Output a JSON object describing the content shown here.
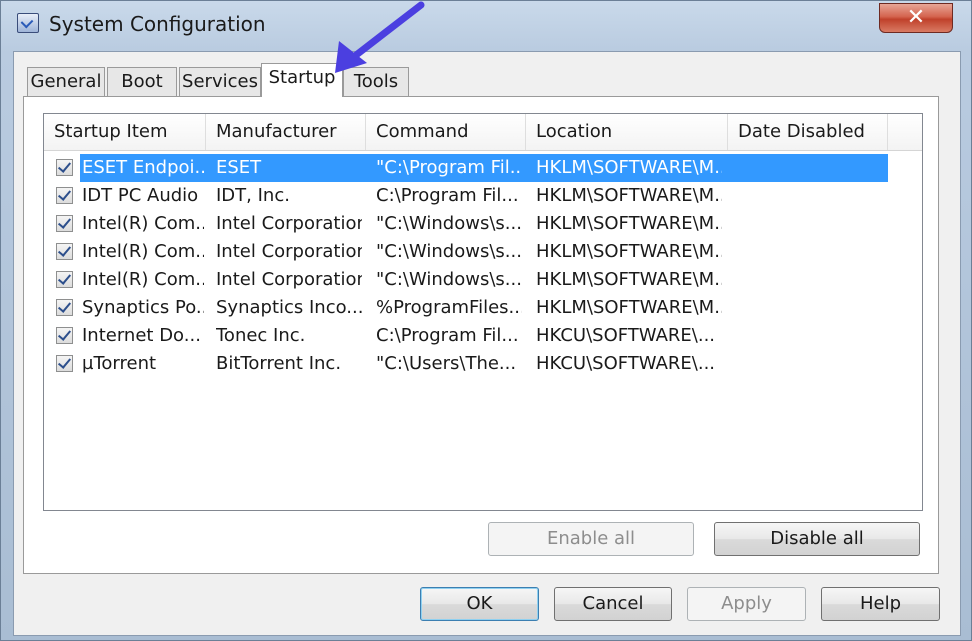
{
  "window": {
    "title": "System Configuration",
    "close_glyph": "✕"
  },
  "tabs": [
    {
      "label": "General",
      "active": false
    },
    {
      "label": "Boot",
      "active": false
    },
    {
      "label": "Services",
      "active": false
    },
    {
      "label": "Startup",
      "active": true
    },
    {
      "label": "Tools",
      "active": false
    }
  ],
  "startup_list": {
    "columns": [
      "Startup Item",
      "Manufacturer",
      "Command",
      "Location",
      "Date Disabled"
    ],
    "rows": [
      {
        "checked": true,
        "selected": true,
        "item": "ESET Endpoi...",
        "manufacturer": "ESET",
        "command": "\"C:\\Program Fil...",
        "location": "HKLM\\SOFTWARE\\M...",
        "date_disabled": ""
      },
      {
        "checked": true,
        "selected": false,
        "item": "IDT PC Audio",
        "manufacturer": "IDT, Inc.",
        "command": "C:\\Program Fil...",
        "location": "HKLM\\SOFTWARE\\M...",
        "date_disabled": ""
      },
      {
        "checked": true,
        "selected": false,
        "item": "Intel(R) Com...",
        "manufacturer": "Intel Corporation",
        "command": "\"C:\\Windows\\s...",
        "location": "HKLM\\SOFTWARE\\M...",
        "date_disabled": ""
      },
      {
        "checked": true,
        "selected": false,
        "item": "Intel(R) Com...",
        "manufacturer": "Intel Corporation",
        "command": "\"C:\\Windows\\s...",
        "location": "HKLM\\SOFTWARE\\M...",
        "date_disabled": ""
      },
      {
        "checked": true,
        "selected": false,
        "item": "Intel(R) Com...",
        "manufacturer": "Intel Corporation",
        "command": "\"C:\\Windows\\s...",
        "location": "HKLM\\SOFTWARE\\M...",
        "date_disabled": ""
      },
      {
        "checked": true,
        "selected": false,
        "item": "Synaptics Po...",
        "manufacturer": "Synaptics Inco...",
        "command": "%ProgramFiles...",
        "location": "HKLM\\SOFTWARE\\M...",
        "date_disabled": ""
      },
      {
        "checked": true,
        "selected": false,
        "item": "Internet Do...",
        "manufacturer": "Tonec Inc.",
        "command": "C:\\Program Fil...",
        "location": "HKCU\\SOFTWARE\\...",
        "date_disabled": ""
      },
      {
        "checked": true,
        "selected": false,
        "item": "µTorrent",
        "manufacturer": "BitTorrent Inc.",
        "command": "\"C:\\Users\\The...",
        "location": "HKCU\\SOFTWARE\\...",
        "date_disabled": ""
      }
    ]
  },
  "panel_buttons": {
    "enable_all": "Enable all",
    "disable_all": "Disable all"
  },
  "dialog_buttons": {
    "ok": "OK",
    "cancel": "Cancel",
    "apply": "Apply",
    "help": "Help"
  },
  "colors": {
    "selection": "#3399ff",
    "annotation_arrow": "#4b3fe0",
    "close_button": "#c94a33"
  },
  "icons": {
    "app": "msconfig-icon",
    "annotation": "arrow-pointer-icon"
  }
}
